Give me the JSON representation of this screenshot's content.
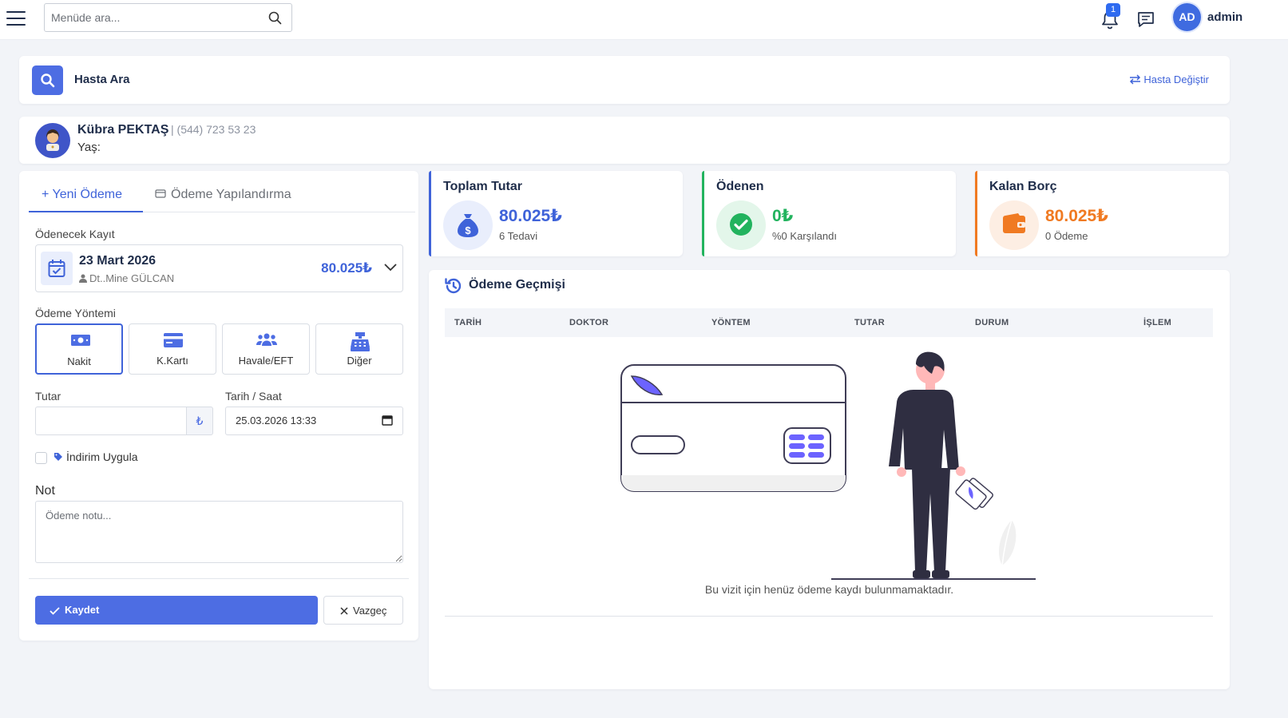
{
  "topbar": {
    "search_placeholder": "Menüde ara...",
    "notification_count": "1",
    "avatar_initials": "AD",
    "user_name": "admin"
  },
  "patient_search": {
    "title": "Hasta Ara",
    "change_link": "Hasta Değiştir"
  },
  "patient": {
    "name": "Kübra PEKTAŞ",
    "phone": "| (544) 723 53 23",
    "age_label": "Yaş:"
  },
  "tabs": {
    "new_payment": "+ Yeni Ödeme",
    "restructure": "Ödeme Yapılandırma"
  },
  "form": {
    "record_label": "Ödenecek Kayıt",
    "record_date": "23 Mart 2026",
    "record_doctor": "Dt..Mine GÜLCAN",
    "record_amount": "80.025₺",
    "method_label": "Ödeme Yöntemi",
    "methods": [
      {
        "label": "Nakit",
        "icon": "cash-icon",
        "selected": true
      },
      {
        "label": "K.Kartı",
        "icon": "credit-card-icon",
        "selected": false
      },
      {
        "label": "Havale/EFT",
        "icon": "users-icon",
        "selected": false
      },
      {
        "label": "Diğer",
        "icon": "cash-register-icon",
        "selected": false
      }
    ],
    "amount_label": "Tutar",
    "amount_value": "",
    "currency_symbol": "₺",
    "datetime_label": "Tarih / Saat",
    "datetime_value": "25.03.2026 13:33",
    "discount_label": "İndirim Uygula",
    "note_label": "Not",
    "note_placeholder": "Ödeme notu...",
    "save_button": "Kaydet",
    "cancel_button": "Vazgeç"
  },
  "stats": [
    {
      "title": "Toplam Tutar",
      "value": "80.025₺",
      "sub": "6 Tedavi",
      "color": "#3f63d9",
      "bg": "#e9eefc",
      "icon": "money-bag-icon"
    },
    {
      "title": "Ödenen",
      "value": "0₺",
      "sub": "%0 Karşılandı",
      "color": "#22b35e",
      "bg": "#e3f6ea",
      "icon": "check-circle-icon"
    },
    {
      "title": "Kalan Borç",
      "value": "80.025₺",
      "sub": "0 Ödeme",
      "color": "#f07a22",
      "bg": "#fdeee3",
      "icon": "wallet-icon"
    }
  ],
  "history": {
    "title": "Ödeme Geçmişi",
    "columns": [
      "TARİH",
      "DOKTOR",
      "YÖNTEM",
      "TUTAR",
      "DURUM",
      "İŞLEM"
    ],
    "empty_message": "Bu vizit için henüz ödeme kaydı bulunmamaktadır."
  }
}
